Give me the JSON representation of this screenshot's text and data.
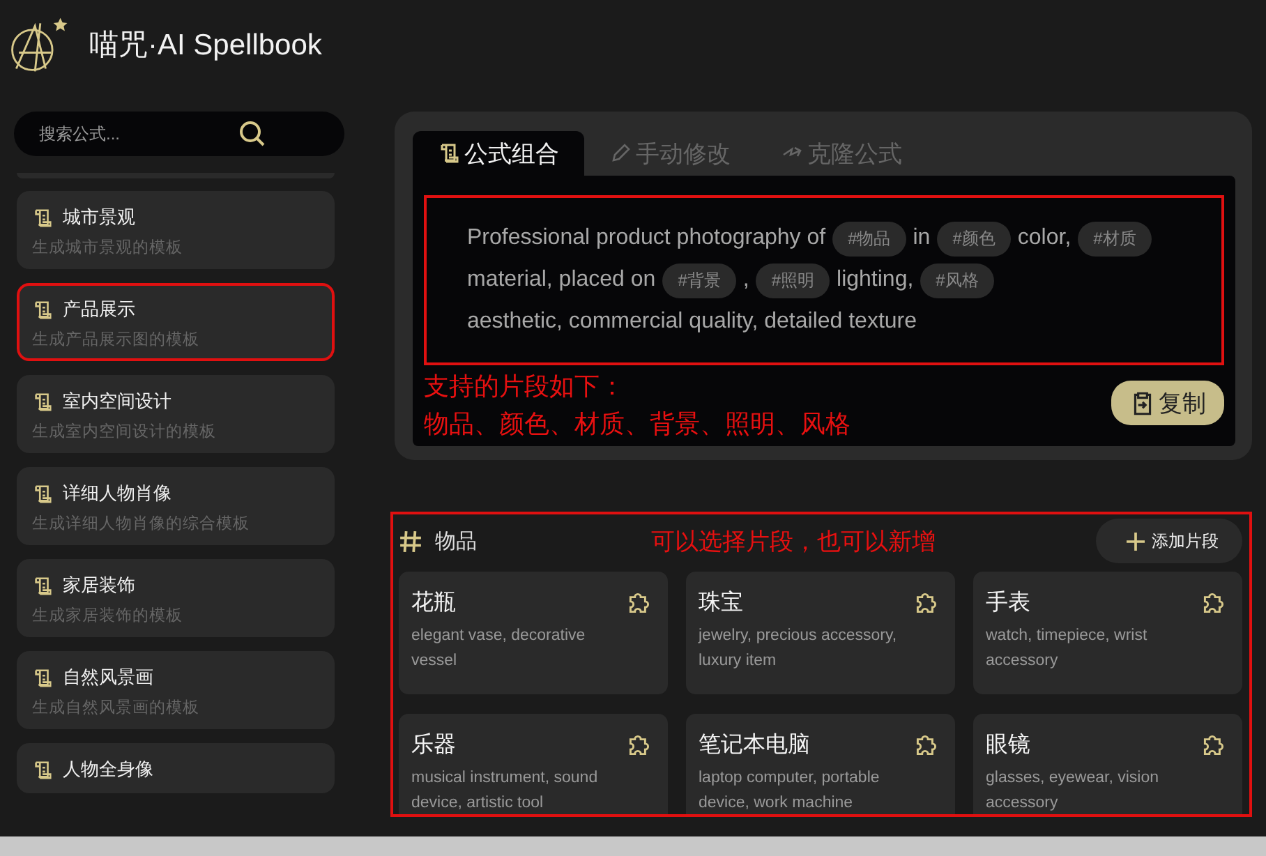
{
  "app": {
    "title": "喵咒·AI Spellbook"
  },
  "search": {
    "placeholder": "搜索公式..."
  },
  "templates": [
    {
      "title": "城市景观",
      "subtitle": "生成城市景观的模板",
      "selected": false
    },
    {
      "title": "产品展示",
      "subtitle": "生成产品展示图的模板",
      "selected": true
    },
    {
      "title": "室内空间设计",
      "subtitle": "生成室内空间设计的模板",
      "selected": false
    },
    {
      "title": "详细人物肖像",
      "subtitle": "生成详细人物肖像的综合模板",
      "selected": false
    },
    {
      "title": "家居装饰",
      "subtitle": "生成家居装饰的模板",
      "selected": false
    },
    {
      "title": "自然风景画",
      "subtitle": "生成自然风景画的模板",
      "selected": false
    },
    {
      "title": "人物全身像",
      "selected": false
    }
  ],
  "tabs": [
    {
      "label": "公式组合",
      "kind": "compose",
      "selected": true
    },
    {
      "label": "手动修改",
      "kind": "edit",
      "selected": false
    },
    {
      "label": "克隆公式",
      "kind": "clone",
      "selected": false
    }
  ],
  "prompt": [
    {
      "kind": "text",
      "text": "Professional product photography of"
    },
    {
      "kind": "chip",
      "text": "#物品"
    },
    {
      "kind": "text",
      "text": "in"
    },
    {
      "kind": "chip",
      "text": "#颜色"
    },
    {
      "kind": "text",
      "text": "color,"
    },
    {
      "kind": "chip",
      "text": "#材质"
    },
    {
      "kind": "text",
      "text": "material, placed on"
    },
    {
      "kind": "chip",
      "text": "#背景"
    },
    {
      "kind": "text",
      "text": ","
    },
    {
      "kind": "chip",
      "text": "#照明"
    },
    {
      "kind": "text",
      "text": "lighting,"
    },
    {
      "kind": "chip",
      "text": "#风格"
    },
    {
      "kind": "break"
    },
    {
      "kind": "text",
      "text": "aesthetic, commercial quality, detailed texture"
    }
  ],
  "copy_button": "复制",
  "annotations": [
    "支持的片段如下：",
    "物品、颜色、材质、背景、照明、风格",
    "可以选择片段，也可以新增"
  ],
  "fragments": {
    "category": "物品",
    "add_button": "添加片段",
    "items": [
      {
        "name": "花瓶",
        "desc": "elegant vase, decorative vessel"
      },
      {
        "name": "珠宝",
        "desc": "jewelry, precious accessory, luxury item"
      },
      {
        "name": "手表",
        "desc": "watch, timepiece, wrist accessory"
      },
      {
        "name": "乐器",
        "desc": "musical instrument, sound device, artistic tool"
      },
      {
        "name": "笔记本电脑",
        "desc": "laptop computer, portable device, work machine"
      },
      {
        "name": "眼镜",
        "desc": "glasses, eyewear, vision accessory"
      }
    ]
  }
}
